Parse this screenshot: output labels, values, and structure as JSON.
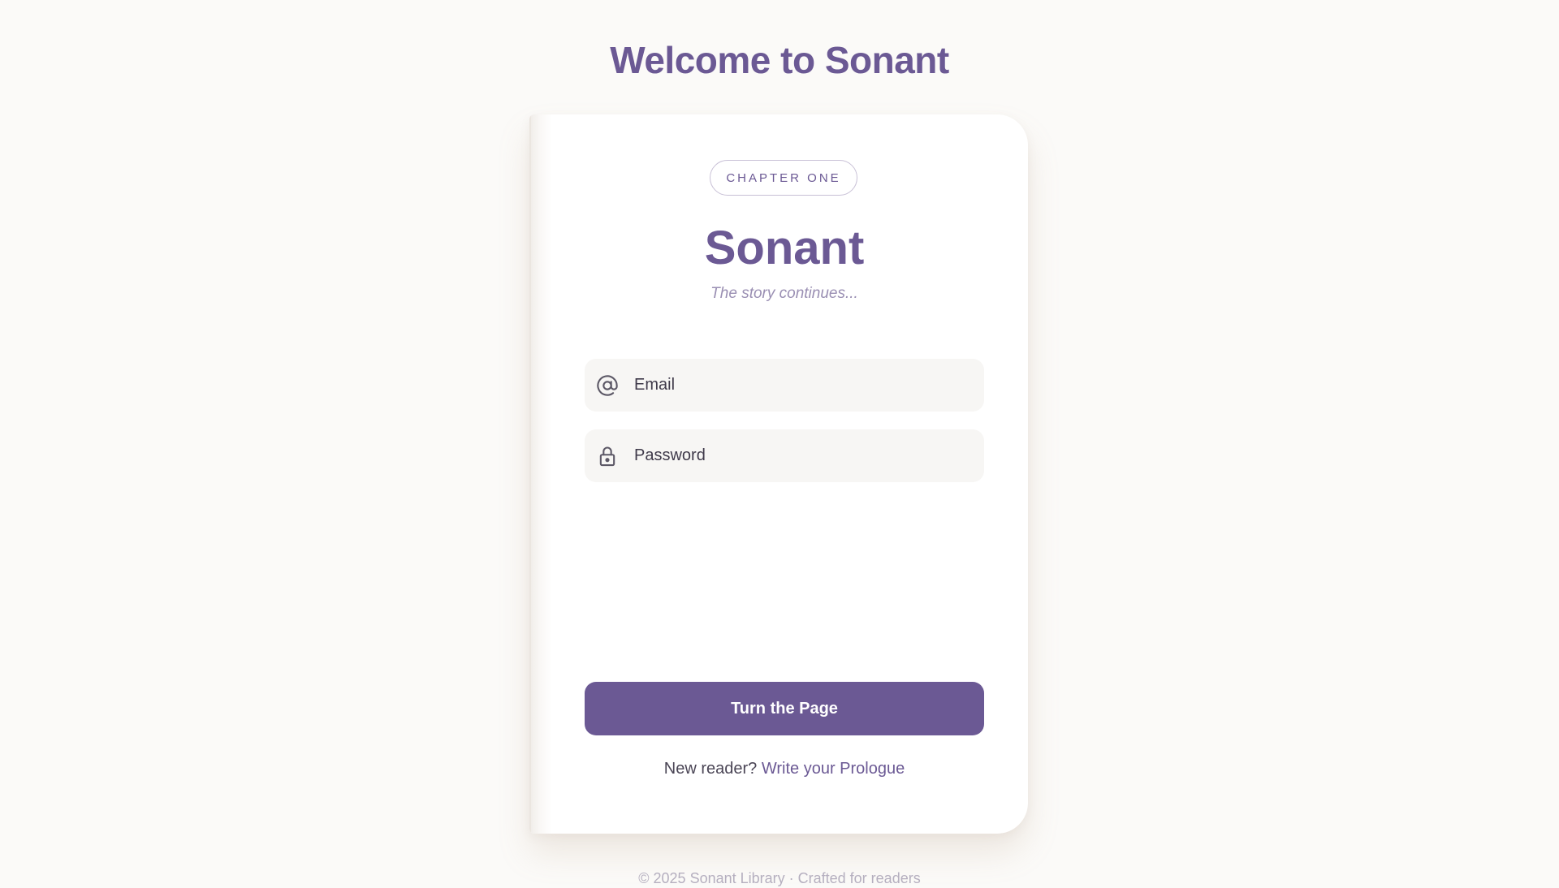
{
  "page": {
    "heading": "Welcome to Sonant"
  },
  "card": {
    "badge": "CHAPTER ONE",
    "title": "Sonant",
    "tagline": "The story continues..."
  },
  "form": {
    "email": {
      "placeholder": "Email",
      "value": "",
      "icon": "at-sign-icon"
    },
    "password": {
      "placeholder": "Password",
      "value": "",
      "icon": "lock-icon"
    },
    "submit_label": "Turn the Page"
  },
  "signup": {
    "prompt": "New reader?",
    "link_label": "Write your Prologue"
  },
  "footer": {
    "text": "© 2025 Sonant Library · Crafted for readers"
  },
  "colors": {
    "accent": "#6b5994",
    "background": "#fbfaf8",
    "field_background": "#f7f6f4"
  }
}
